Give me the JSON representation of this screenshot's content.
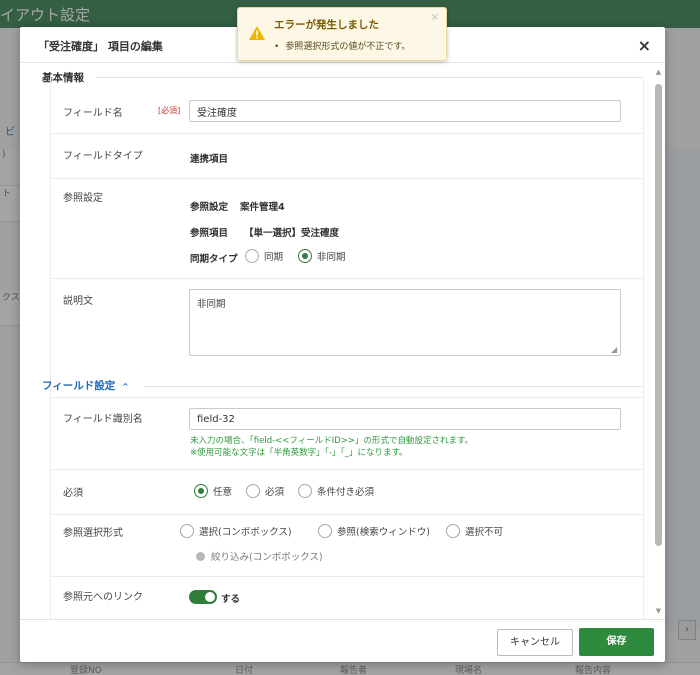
{
  "background": {
    "title": "イアウト設定",
    "strip_labels": [
      ")",
      "ト",
      "クス"
    ],
    "side_char": "ビ",
    "bottom_columns": [
      "登録NO",
      "日付",
      "報告者",
      "現場名",
      "報告内容"
    ],
    "right_button": "›"
  },
  "toast": {
    "title": "エラーが発生しました",
    "message": "参照選択形式の値が不正です。",
    "close": "×",
    "icon": "warning-triangle-icon",
    "accent": "#f0b400"
  },
  "modal": {
    "title": "「受注確度」 項目の編集",
    "close": "×",
    "basic_section": {
      "title": "基本情報",
      "field_name": {
        "label": "フィールド名",
        "required": "[必須]",
        "value": "受注確度"
      },
      "field_type": {
        "label": "フィールドタイプ",
        "value": "連携項目"
      },
      "reference": {
        "label": "参照設定",
        "setting_key": "参照設定",
        "setting_value": "案件管理4",
        "item_key": "参照項目",
        "item_value": "【単一選択】受注確度",
        "sync_key": "同期タイプ",
        "sync_options": [
          "同期",
          "非同期"
        ],
        "sync_selected": "非同期"
      },
      "description": {
        "label": "説明文",
        "value": "非同期"
      }
    },
    "field_section": {
      "title": "フィールド設定",
      "chevron": "^",
      "identifier": {
        "label": "フィールド識別名",
        "value": "field-32",
        "help1": "未入力の場合、「field-<<フィールドID>>」の形式で自動設定されます。",
        "help2": "※使用可能な文字は「半角英数字」「-」「_」になります。"
      },
      "required": {
        "label": "必須",
        "options": [
          "任意",
          "必須",
          "条件付き必須"
        ],
        "selected": "任意"
      },
      "ref_format": {
        "label": "参照選択形式",
        "options": [
          "選択(コンボボックス)",
          "参照(検索ウィンドウ)",
          "選択不可"
        ],
        "disabled_option": "絞り込み(コンボボックス)"
      },
      "link": {
        "label": "参照元へのリンク",
        "toggle_label": "する",
        "on": true
      }
    },
    "footer": {
      "cancel": "キャンセル",
      "save": "保存"
    },
    "colors": {
      "primary": "#2e8b3e",
      "link": "#1d6ab7",
      "required": "#c0392b",
      "help": "#2e9a3e"
    }
  }
}
